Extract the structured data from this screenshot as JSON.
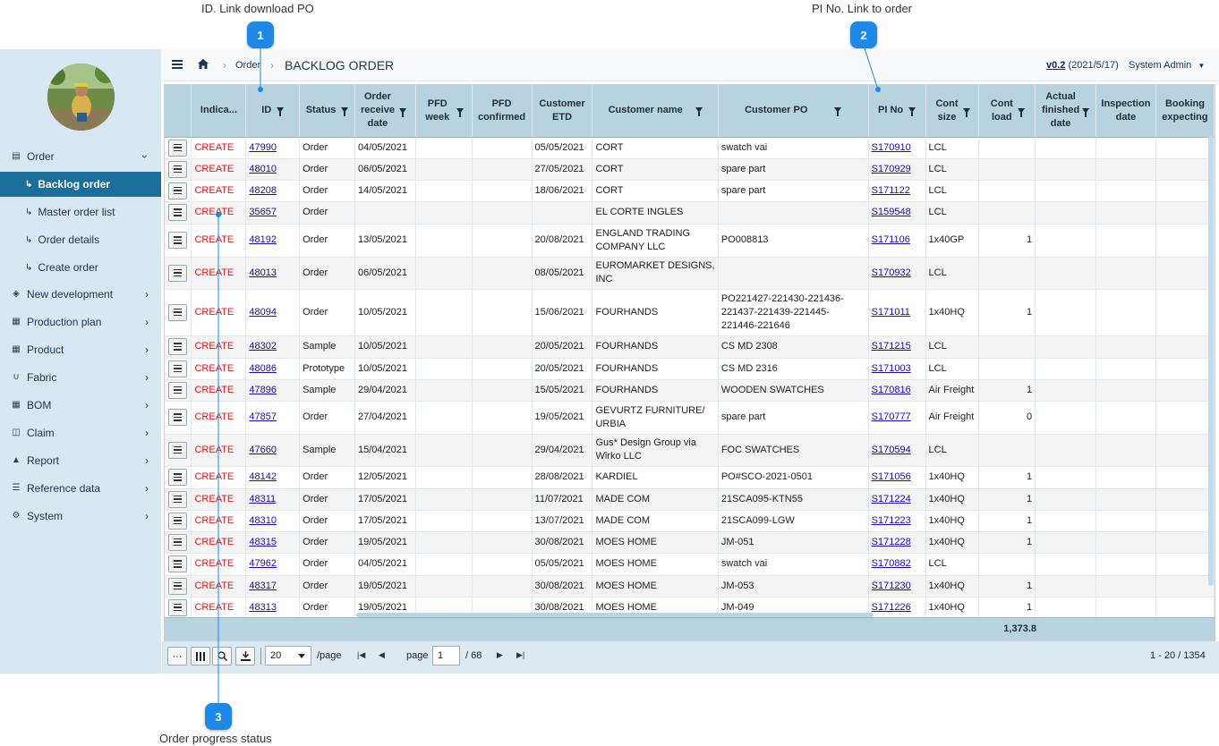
{
  "callouts": {
    "c1_label": "ID. Link download PO",
    "c2_label": "PI No. Link to order",
    "c3_label": "Order progress status",
    "c1_num": "1",
    "c2_num": "2",
    "c3_num": "3"
  },
  "sidebar": {
    "items": [
      {
        "label": "Order",
        "icon": "document-icon"
      },
      {
        "label": "Backlog order"
      },
      {
        "label": "Master order list"
      },
      {
        "label": "Order details"
      },
      {
        "label": "Create order"
      },
      {
        "label": "New development",
        "icon": "cube-icon"
      },
      {
        "label": "Production plan",
        "icon": "grid-icon"
      },
      {
        "label": "Product",
        "icon": "grid-icon"
      },
      {
        "label": "Fabric",
        "icon": "magnet-icon"
      },
      {
        "label": "BOM",
        "icon": "table-icon"
      },
      {
        "label": "Claim",
        "icon": "claim-icon"
      },
      {
        "label": "Report",
        "icon": "sitemap-icon"
      },
      {
        "label": "Reference data",
        "icon": "database-icon"
      },
      {
        "label": "System",
        "icon": "gear-icon"
      }
    ]
  },
  "header": {
    "crumb_order": "Order",
    "title": "BACKLOG ORDER",
    "version": "v0.2",
    "version_date": "(2021/5/17)",
    "user": "System Admin"
  },
  "table": {
    "headers": {
      "indicator": "Indica...",
      "id": "ID",
      "status": "Status",
      "order_receive_date": "Order receive date",
      "pfd_week": "PFD week",
      "pfd_confirmed": "PFD confirmed",
      "customer_etd": "Customer ETD",
      "customer_name": "Customer name",
      "customer_po": "Customer PO",
      "pi_no": "PI No",
      "cont_size": "Cont size",
      "cont_load": "Cont load",
      "actual_finished_date": "Actual finished date",
      "inspection_date": "Inspection date",
      "booking_expecting": "Booking expecting"
    },
    "rows": [
      {
        "ind": "CREATE",
        "id": "47990",
        "status": "Order",
        "ord": "04/05/2021",
        "etd": "05/05/2021",
        "cust": "CORT",
        "po": "swatch vai",
        "pi": "S170910",
        "size": "LCL",
        "load": ""
      },
      {
        "ind": "CREATE",
        "id": "48010",
        "status": "Order",
        "ord": "06/05/2021",
        "etd": "27/05/2021",
        "cust": "CORT",
        "po": "spare part",
        "pi": "S170929",
        "size": "LCL",
        "load": ""
      },
      {
        "ind": "CREATE",
        "id": "48208",
        "status": "Order",
        "ord": "14/05/2021",
        "etd": "18/06/2021",
        "cust": "CORT",
        "po": "spare part",
        "pi": "S171122",
        "size": "LCL",
        "load": ""
      },
      {
        "ind": "CREATE",
        "id": "35657",
        "status": "Order",
        "ord": "",
        "etd": "",
        "cust": "EL CORTE INGLES",
        "po": "",
        "pi": "S159548",
        "size": "LCL",
        "load": ""
      },
      {
        "ind": "CREATE",
        "id": "48192",
        "status": "Order",
        "ord": "13/05/2021",
        "etd": "20/08/2021",
        "cust": "ENGLAND TRADING COMPANY LLC",
        "po": "PO008813",
        "pi": "S171106",
        "size": "1x40GP",
        "load": "1"
      },
      {
        "ind": "CREATE",
        "id": "48013",
        "status": "Order",
        "ord": "06/05/2021",
        "etd": "08/05/2021",
        "cust": "EUROMARKET DESIGNS, INC",
        "po": "",
        "pi": "S170932",
        "size": "LCL",
        "load": ""
      },
      {
        "ind": "CREATE",
        "id": "48094",
        "status": "Order",
        "ord": "10/05/2021",
        "etd": "15/06/2021",
        "cust": "FOURHANDS",
        "po": "PO221427-221430-221436-221437-221439-221445-221446-221646",
        "pi": "S171011",
        "size": "1x40HQ",
        "load": "1"
      },
      {
        "ind": "CREATE",
        "id": "48302",
        "status": "Sample",
        "ord": "10/05/2021",
        "etd": "20/05/2021",
        "cust": "FOURHANDS",
        "po": "CS MD 2308",
        "pi": "S171215",
        "size": "LCL",
        "load": ""
      },
      {
        "ind": "CREATE",
        "id": "48086",
        "status": "Prototype",
        "ord": "10/05/2021",
        "etd": "20/05/2021",
        "cust": "FOURHANDS",
        "po": "CS MD 2316",
        "pi": "S171003",
        "size": "LCL",
        "load": ""
      },
      {
        "ind": "CREATE",
        "id": "47896",
        "status": "Sample",
        "ord": "29/04/2021",
        "etd": "15/05/2021",
        "cust": "FOURHANDS",
        "po": "WOODEN SWATCHES",
        "pi": "S170816",
        "size": "Air Freight",
        "load": "1"
      },
      {
        "ind": "CREATE",
        "id": "47857",
        "status": "Order",
        "ord": "27/04/2021",
        "etd": "19/05/2021",
        "cust": "GEVURTZ FURNITURE/ URBIA",
        "po": "spare part",
        "pi": "S170777",
        "size": "Air Freight",
        "load": "0"
      },
      {
        "ind": "CREATE",
        "id": "47660",
        "status": "Sample",
        "ord": "15/04/2021",
        "etd": "29/04/2021",
        "cust": "Gus* Design Group via Wirko LLC",
        "po": "FOC SWATCHES",
        "pi": "S170594",
        "size": "LCL",
        "load": ""
      },
      {
        "ind": "CREATE",
        "id": "48142",
        "status": "Order",
        "ord": "12/05/2021",
        "etd": "28/08/2021",
        "cust": "KARDIEL",
        "po": "PO#SCO-2021-0501",
        "pi": "S171056",
        "size": "1x40HQ",
        "load": "1"
      },
      {
        "ind": "CREATE",
        "id": "48311",
        "status": "Order",
        "ord": "17/05/2021",
        "etd": "11/07/2021",
        "cust": "MADE COM",
        "po": "21SCA095-KTN55",
        "pi": "S171224",
        "size": "1x40HQ",
        "load": "1"
      },
      {
        "ind": "CREATE",
        "id": "48310",
        "status": "Order",
        "ord": "17/05/2021",
        "etd": "13/07/2021",
        "cust": "MADE COM",
        "po": "21SCA099-LGW",
        "pi": "S171223",
        "size": "1x40HQ",
        "load": "1"
      },
      {
        "ind": "CREATE",
        "id": "48315",
        "status": "Order",
        "ord": "19/05/2021",
        "etd": "30/08/2021",
        "cust": "MOES HOME",
        "po": "JM-051",
        "pi": "S171228",
        "size": "1x40HQ",
        "load": "1"
      },
      {
        "ind": "CREATE",
        "id": "47962",
        "status": "Order",
        "ord": "04/05/2021",
        "etd": "05/05/2021",
        "cust": "MOES HOME",
        "po": "swatch vai",
        "pi": "S170882",
        "size": "LCL",
        "load": ""
      },
      {
        "ind": "CREATE",
        "id": "48317",
        "status": "Order",
        "ord": "19/05/2021",
        "etd": "30/08/2021",
        "cust": "MOES HOME",
        "po": "JM-053",
        "pi": "S171230",
        "size": "1x40HQ",
        "load": "1"
      },
      {
        "ind": "CREATE",
        "id": "48313",
        "status": "Order",
        "ord": "19/05/2021",
        "etd": "30/08/2021",
        "cust": "MOES HOME",
        "po": "JM-049",
        "pi": "S171226",
        "size": "1x40HQ",
        "load": "1"
      }
    ],
    "total_cont_load": "1,373.8"
  },
  "pager": {
    "more": "···",
    "page_size": "20",
    "per_page": "/page",
    "page_label": "page",
    "page_value": "1",
    "page_total": "/ 68",
    "range": "1 - 20 / 1354"
  },
  "colors": {
    "accent": "#1e88e5",
    "sidebar_bg": "#d7e8f2",
    "active": "#1a6e99",
    "header_bg": "#b8d3e0",
    "indicator": "#e11111"
  }
}
